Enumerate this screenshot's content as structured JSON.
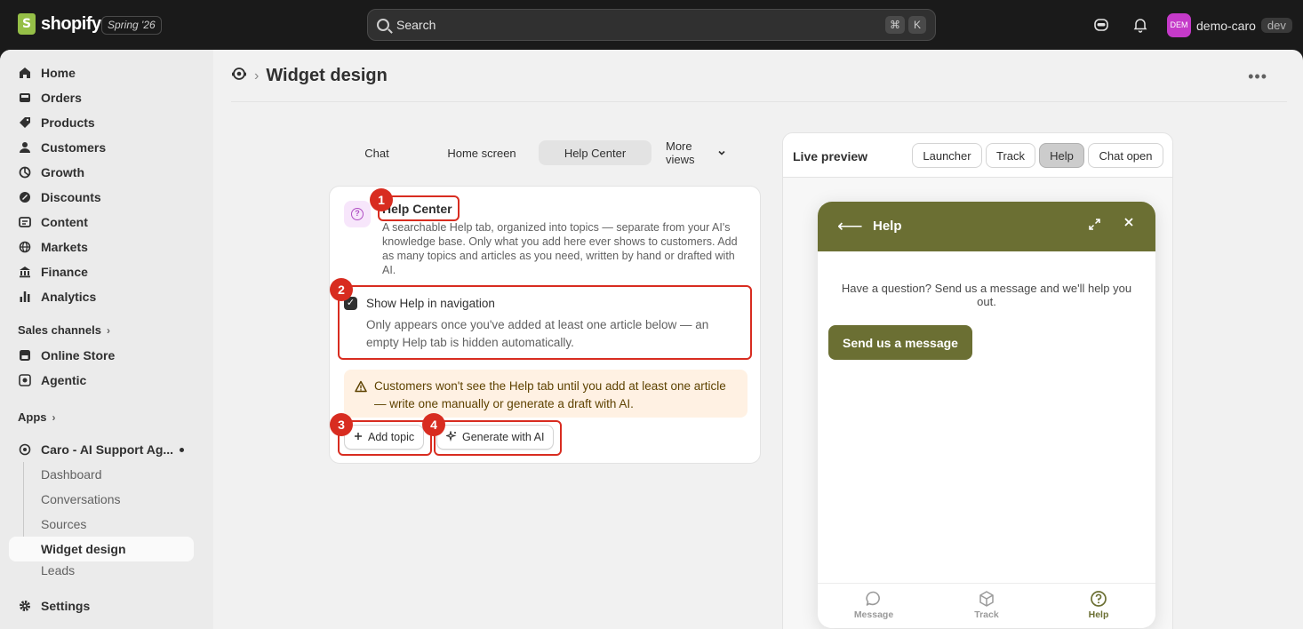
{
  "topbar": {
    "logo_text": "shopify",
    "edition": "Spring '26",
    "search_placeholder": "Search",
    "shortcut_keys": [
      "⌘",
      "K"
    ],
    "user": {
      "initials": "DEM",
      "name": "demo-caro",
      "env": "dev"
    }
  },
  "sidebar": {
    "items": [
      {
        "label": "Home",
        "icon": "home-icon"
      },
      {
        "label": "Orders",
        "icon": "inbox-icon"
      },
      {
        "label": "Products",
        "icon": "tag-icon"
      },
      {
        "label": "Customers",
        "icon": "person-icon"
      },
      {
        "label": "Growth",
        "icon": "growth-icon"
      },
      {
        "label": "Discounts",
        "icon": "discount-icon"
      },
      {
        "label": "Content",
        "icon": "content-icon"
      },
      {
        "label": "Markets",
        "icon": "globe-icon"
      },
      {
        "label": "Finance",
        "icon": "bank-icon"
      },
      {
        "label": "Analytics",
        "icon": "chart-icon"
      }
    ],
    "sales_channels_title": "Sales channels",
    "channels": [
      {
        "label": "Online Store",
        "icon": "store-icon"
      },
      {
        "label": "Agentic",
        "icon": "agentic-icon"
      }
    ],
    "apps_title": "Apps",
    "app": {
      "label": "Caro - AI Support Ag...",
      "subitems": [
        "Dashboard",
        "Conversations",
        "Sources",
        "Widget design",
        "Leads"
      ]
    },
    "settings_label": "Settings"
  },
  "page": {
    "title": "Widget design"
  },
  "tabs": [
    "Chat",
    "Home screen",
    "Help Center",
    "More views"
  ],
  "help_card": {
    "title": "Help Center",
    "description": "A searchable Help tab, organized into topics — separate from your AI's knowledge base. Only what you add here ever shows to customers. Add as many topics and articles as you need, written by hand or drafted with AI.",
    "checkbox_label": "Show Help in navigation",
    "checkbox_checked": true,
    "checkbox_help": "Only appears once you've added at least one article below — an empty Help tab is hidden automatically.",
    "banner_text": "Customers won't see the Help tab until you add at least one article — write one manually or generate a draft with AI.",
    "add_topic_label": "Add topic",
    "generate_label": "Generate with AI"
  },
  "annotations": [
    "1",
    "2",
    "3",
    "4"
  ],
  "preview": {
    "title": "Live preview",
    "modes": [
      "Launcher",
      "Track",
      "Help",
      "Chat open"
    ],
    "active_mode": "Help",
    "widget": {
      "header_title": "Help",
      "message": "Have a question? Send us a message and we'll help you out.",
      "cta": "Send us a message",
      "nav": [
        "Message",
        "Track",
        "Help"
      ],
      "active_nav": "Help",
      "accent_color": "#6b6f33"
    }
  },
  "colors": {
    "annotation_red": "#d82c20",
    "topbar_bg": "#1a1a1a",
    "banner_bg": "#fff1e3"
  }
}
